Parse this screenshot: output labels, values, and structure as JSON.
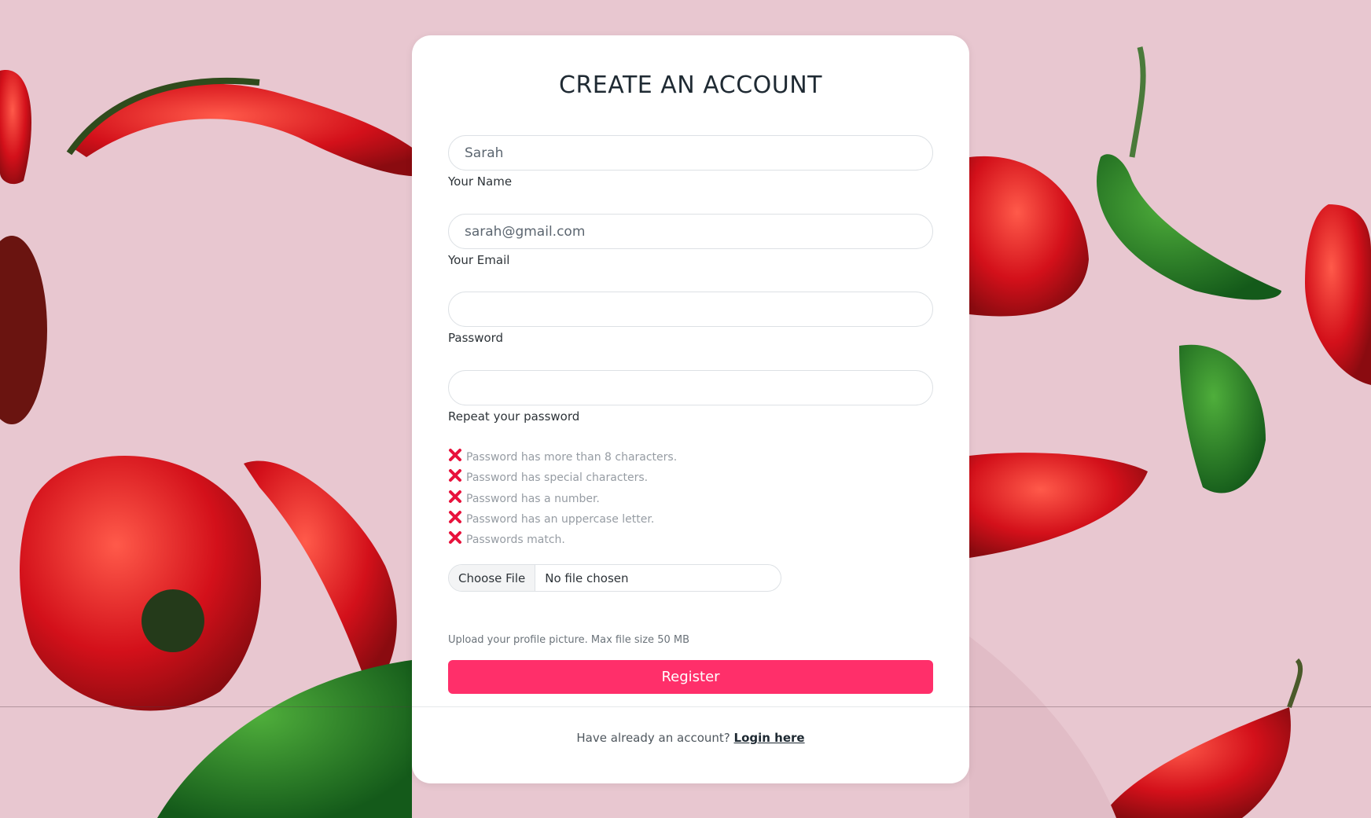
{
  "form": {
    "title": "CREATE AN ACCOUNT",
    "name": {
      "value": "Sarah",
      "label": "Your Name"
    },
    "email": {
      "value": "sarah@gmail.com",
      "label": "Your Email"
    },
    "password": {
      "value": "",
      "label": "Password"
    },
    "repeat_password": {
      "value": "",
      "label": "Repeat your password"
    },
    "password_rules": [
      "Password has more than 8 characters.",
      "Password has special characters.",
      "Password has a number.",
      "Password has an uppercase letter.",
      "Passwords match."
    ],
    "file": {
      "button_label": "Choose File",
      "status": "No file chosen",
      "hint": "Upload your profile picture. Max file size 50 MB"
    },
    "submit_label": "Register",
    "footer": {
      "prompt": "Have already an account?",
      "link_label": "Login here"
    }
  },
  "colors": {
    "accent": "#ff2f6a",
    "rule_fail": "#e8123c",
    "background": "#e7c6cf"
  }
}
